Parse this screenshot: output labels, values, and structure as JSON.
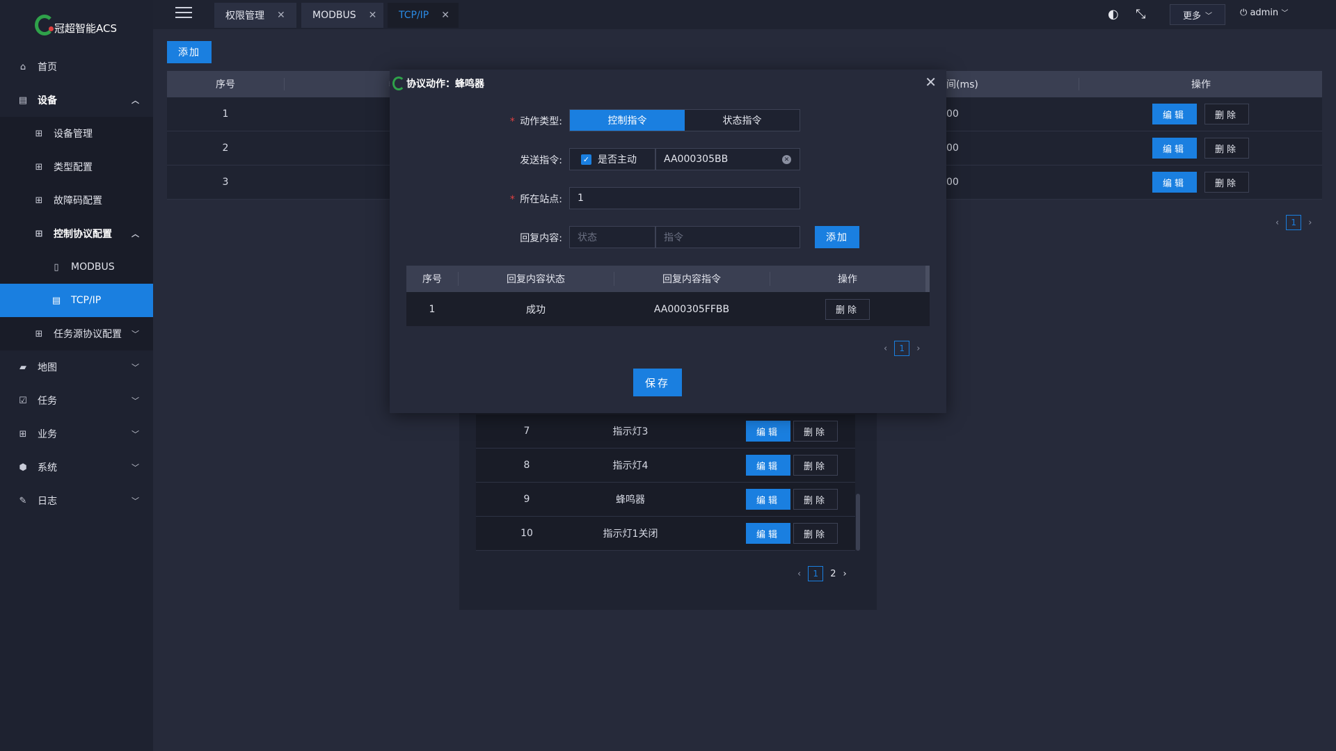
{
  "app": {
    "logo_text": "冠超智能ACS"
  },
  "sidebar": {
    "items": [
      {
        "label": "首页"
      },
      {
        "label": "设备"
      },
      {
        "label": "设备管理"
      },
      {
        "label": "类型配置"
      },
      {
        "label": "故障码配置"
      },
      {
        "label": "控制协议配置"
      },
      {
        "label": "MODBUS"
      },
      {
        "label": "TCP/IP"
      },
      {
        "label": "任务源协议配置"
      },
      {
        "label": "地图"
      },
      {
        "label": "任务"
      },
      {
        "label": "业务"
      },
      {
        "label": "系统"
      },
      {
        "label": "日志"
      }
    ]
  },
  "tabs": [
    {
      "label": "权限管理"
    },
    {
      "label": "MODBUS"
    },
    {
      "label": "TCP/IP"
    }
  ],
  "header": {
    "more_label": "更多",
    "user": "admin"
  },
  "main": {
    "add_label": "添加",
    "columns": {
      "index": "序号",
      "time_partial": "间(ms)",
      "ops": "操作"
    },
    "header_partial_char": "≡",
    "rows": [
      {
        "index": "1",
        "time": "00"
      },
      {
        "index": "2",
        "time": "00"
      },
      {
        "index": "3",
        "time": "00"
      }
    ],
    "edit_label": "编辑",
    "delete_label": "删除",
    "pager": {
      "current": "1"
    }
  },
  "under_dialog": {
    "rows": [
      {
        "index": "7",
        "name": "指示灯3"
      },
      {
        "index": "8",
        "name": "指示灯4"
      },
      {
        "index": "9",
        "name": "蜂鸣器"
      },
      {
        "index": "10",
        "name": "指示灯1关闭"
      }
    ],
    "pager": {
      "current": "1",
      "next": "2"
    }
  },
  "modal": {
    "title": "协议动作：蜂鸣器",
    "action_type_label": "动作类型:",
    "action_type_options": [
      "控制指令",
      "状态指令"
    ],
    "send_cmd_label": "发送指令:",
    "active_checkbox_label": "是否主动",
    "send_cmd_value": "AA000305BB",
    "station_label": "所在站点:",
    "station_value": "1",
    "reply_label": "回复内容:",
    "reply_status_placeholder": "状态",
    "reply_cmd_placeholder": "指令",
    "add_label": "添加",
    "table_columns": [
      "序号",
      "回复内容状态",
      "回复内容指令",
      "操作"
    ],
    "table_rows": [
      {
        "index": "1",
        "status": "成功",
        "cmd": "AA000305FFBB"
      }
    ],
    "delete_label": "删除",
    "pager": {
      "current": "1"
    },
    "save_label": "保存"
  }
}
